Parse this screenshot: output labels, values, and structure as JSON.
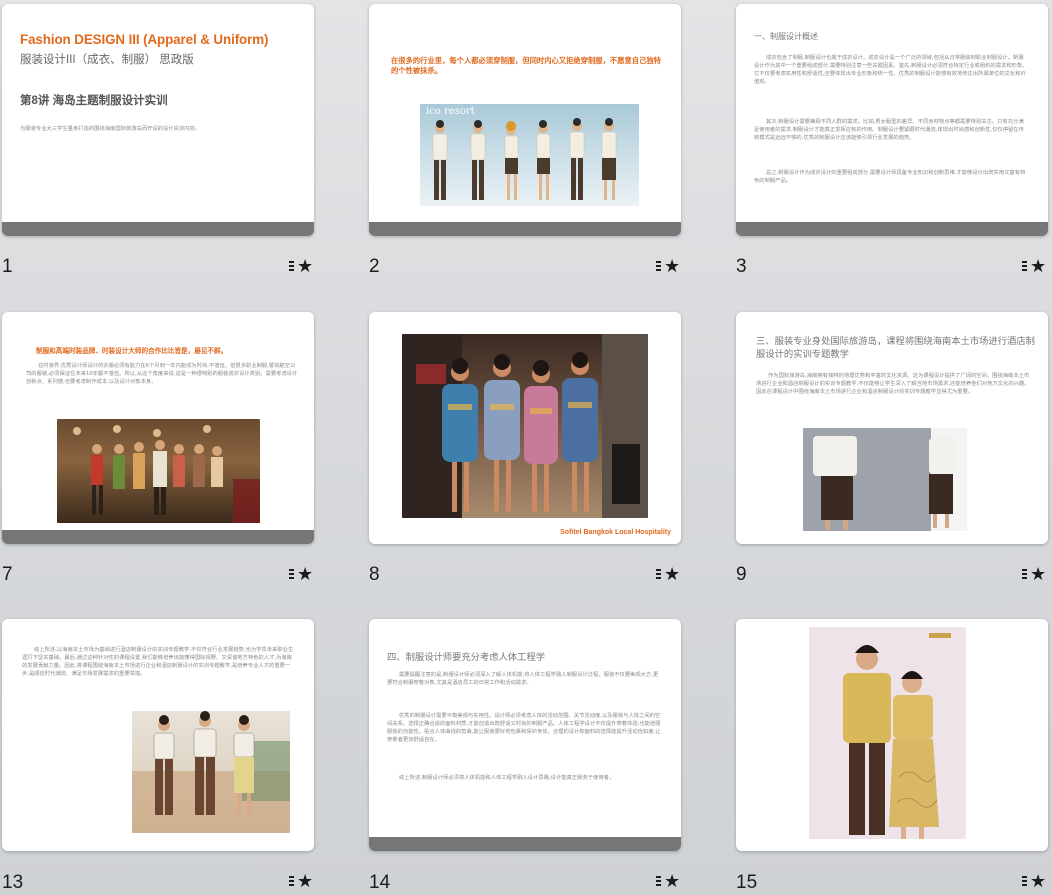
{
  "slides": [
    {
      "number": "1",
      "title_en": "Fashion DESIGN III (Apparel & Uniform)",
      "title_cn": "服装设计III（成衣、制服） 思政版",
      "lecture": "第8讲  海岛主题制服设计实训",
      "desc": "为服装专业大三学生量身打造的围绕海南国际旅游岛而开设的设计实训内容。"
    },
    {
      "number": "2",
      "headline": "在很多的行业里，每个人都必须穿制服，但同时内心又拒绝穿制服，不愿意自己独特的个性被抹杀。",
      "brand": "ico resort"
    },
    {
      "number": "3",
      "heading": "一、制服设计概述",
      "p1": "成衣包含了制服,制服设计也属于成衣设计。成衣设计是一个广泛的领域,包括从日常服装到职业制服设计。制服设计作为其中一个重要组成部分,需要特别注意一些关键因素。首先,制服设计必须符合特定行业或组织的需求和形象。它不仅要考虑实用性和舒适性,还要体现出专业形象和统一性。优秀的制服设计能够有效地传达出所属单位的文化和价值观。",
      "p2": "其次,制服设计需要兼顾不同人群的需求。比如,男女服型的差异、不同身材特点等都需要特别关注。只有充分满足使用者的需求,制服设计才能真正发挥应有的作用。制服设计要紧跟时代潮流,体现出时尚感和创新性,仅仅停留在传统模式是远远不够的,优秀的制服设计应该能够引领行业发展的趋势。",
      "p3": "总之,制服设计作为成衣设计的重要组成部分,需要设计师具备专业知识和创新思维,才能够设计出既实用又富有特色的制服产品。"
    },
    {
      "number": "7",
      "headline": "制服和高端时装品牌、时装设计大师的合作比比皆是，屡见不鲜。",
      "para": "在时装界,优秀设计师设计的衣服必须有能力在6个月到一年内能成为时尚,不落伍。但很多职业制服,譬如航空公司的服装,必须保证在未来10年都不落伍。所以,从这个角度来说,这是一种很特别的服装成衣设计类别。需要考虑设计创新点、系列感,也要考虑制作成本,以及设计对象本身。"
    },
    {
      "number": "8",
      "caption": "Sofitel Bangkok Local Hospitality"
    },
    {
      "number": "9",
      "heading": "三、服装专业身处国际旅游岛，课程将围绕海南本土市场进行酒店制服设计的实训专题教学",
      "para": "作为国际旅游岛,海南拥有独特的地理优势和丰富的文化资源。这为课程设计提供了广阔的空间。围绕海南本土市场进行企业和酒店制服设计的实训专题教学,不仅能够让学生深入了解当地市场需求,还能培养他们对地方文化的兴趣。因此在课程设计中围绕海南本土市场进行企业和酒店制服设计的实训专题教学显得尤为重要。"
    },
    {
      "number": "13",
      "para": "综上所述,以海南本土市场为基础进行酒店制服设计的实训专题教学,不仅符合行业发展趋势,也为学员未来职业生涯打下坚实基础。最后,通过这种针对性的课程设置,我们能够培养出能懂得国际视野、又深谙地方特色的人才,为海南的发展贡献力量。因此,将课程围绕海南本土市场进行企业和酒店制服设计的实训专题教学,是培养专业人才的重要一步,是顺应时代潮流、满足市场发展需求的重要举措。"
    },
    {
      "number": "14",
      "heading": "四、制服设计师要充分考虑人体工程学",
      "p1": "需要提醒注意的是,制服设计师必须深入了解人体机能,将人体工程学融入制服设计过程。服装不仅要美观大方,更要符合制服穿着对象,尤其是酒店员工的日常工作和活动需求。",
      "p2": "优秀的制服设计需要平衡美观与实用性。设计师必须考虑人体的活动范围、关节活动度,以及服装与人体之间的空间关系。选择正确合适的面料材质,才能创造出既舒适又时尚的制服产品。人体工程学设计不仅提升穿着体验,也能增强服装的功能性。贴合人体曲线的剪裁,能让服装更好地包裹和保护身体。合理的设计和面料的选择能提升活动自如度,让穿着者更加舒适自在。",
      "p3": "综上所述,制服设计师必须将人体机能和人体工程学融入设计思路,设计能真正服务于使用者。"
    },
    {
      "number": "15"
    }
  ],
  "colors": {
    "accent_orange": "#e06a1e",
    "card_bar": "#767676",
    "background": "#d9dbde"
  },
  "icons": {
    "star_button": "bulleted-star-icon"
  }
}
